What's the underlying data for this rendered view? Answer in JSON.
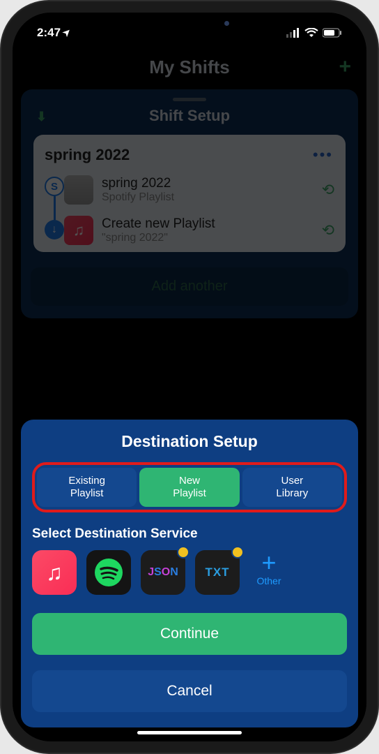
{
  "status": {
    "time": "2:47",
    "loc_arrow": "➤"
  },
  "backdrop": {
    "nav_title": "My Shifts",
    "sheet_title": "Shift Setup",
    "card_title": "spring 2022",
    "source": {
      "title": "spring 2022",
      "subtitle": "Spotify Playlist"
    },
    "dest": {
      "title": "Create new Playlist",
      "subtitle": "\"spring 2022\""
    },
    "add_another": "Add another"
  },
  "dest": {
    "title": "Destination Setup",
    "segments": [
      "Existing\nPlaylist",
      "New\nPlaylist",
      "User\nLibrary"
    ],
    "active_index": 1,
    "service_label": "Select Destination Service",
    "services": {
      "apple_music": "♫",
      "spotify": "spotify",
      "json": "JSON",
      "txt": "TXT",
      "other_label": "Other"
    },
    "continue": "Continue",
    "cancel": "Cancel"
  }
}
